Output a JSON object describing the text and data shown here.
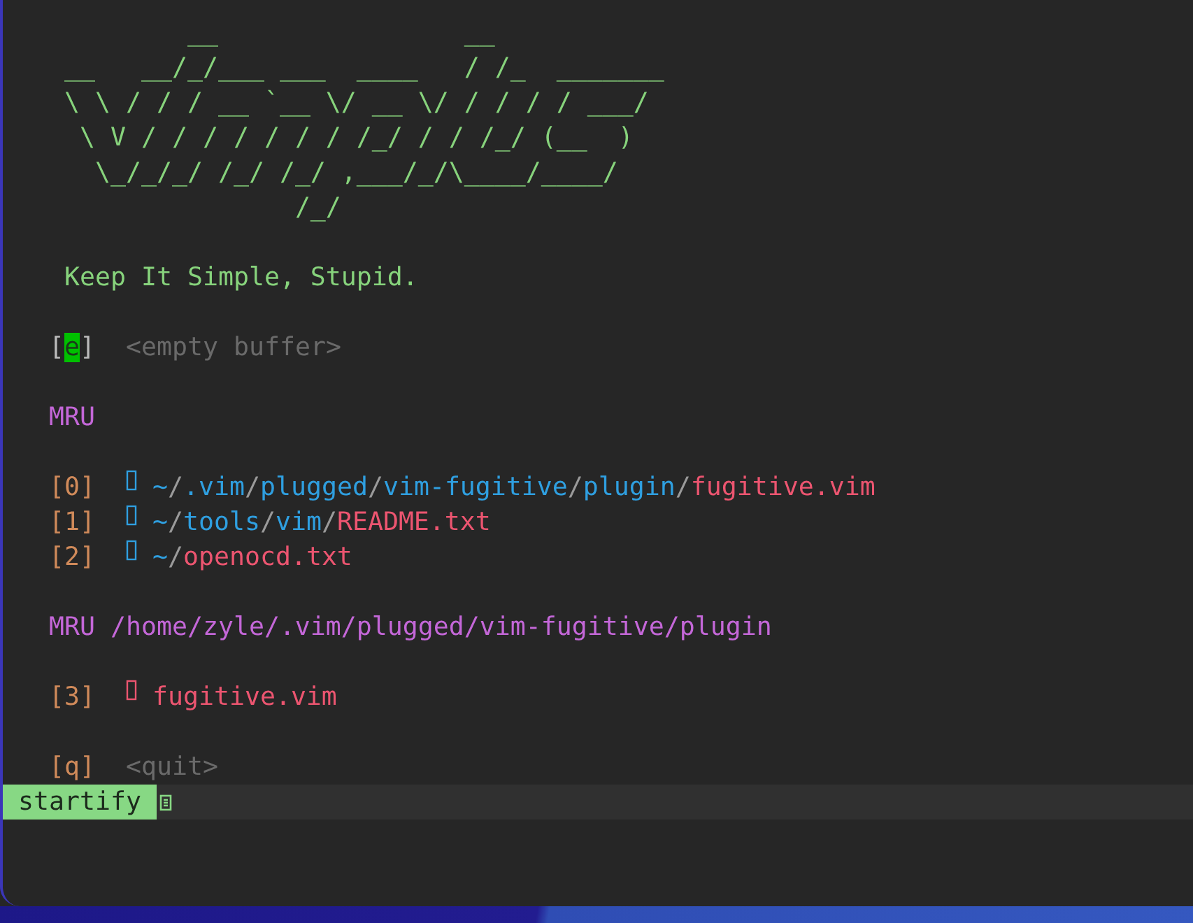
{
  "header_art": [
    "            __                __",
    "    __   __/_/___ ___  ____   / /_  _______",
    "    \\ \\ / / / __ `__ \\/ __ \\/ / / / / ___/",
    "     \\ V / / / / / / / /_/ / / /_/ (__  )",
    "      \\_/_/_/ /_/ /_/ ,___/_/\\____/____/",
    "                   /_/"
  ],
  "tagline": "Keep It Simple, Stupid.",
  "groups": [
    {
      "items": [
        {
          "kind": "command",
          "key": "[e]",
          "cursor": true,
          "label": "<empty buffer>"
        }
      ]
    },
    {
      "heading": "MRU",
      "items": [
        {
          "kind": "file",
          "key": "[0]",
          "cursor": false,
          "dir": "~/.vim/plugged/vim-fugitive/plugin/",
          "file": "fugitive.vim"
        },
        {
          "kind": "file",
          "key": "[1]",
          "cursor": false,
          "dir": "~/tools/vim/",
          "file": "README.txt"
        },
        {
          "kind": "file",
          "key": "[2]",
          "cursor": false,
          "dir": "~/",
          "file": "openocd.txt"
        }
      ]
    },
    {
      "heading": "MRU /home/zyle/.vim/plugged/vim-fugitive/plugin",
      "items": [
        {
          "kind": "file",
          "key": "[3]",
          "cursor": false,
          "file": "fugitive.vim"
        }
      ]
    },
    {
      "items": [
        {
          "kind": "command",
          "key": "[q]",
          "cursor": false,
          "label": "<quit>"
        }
      ]
    }
  ],
  "status_bar": {
    "mode": "startify"
  }
}
